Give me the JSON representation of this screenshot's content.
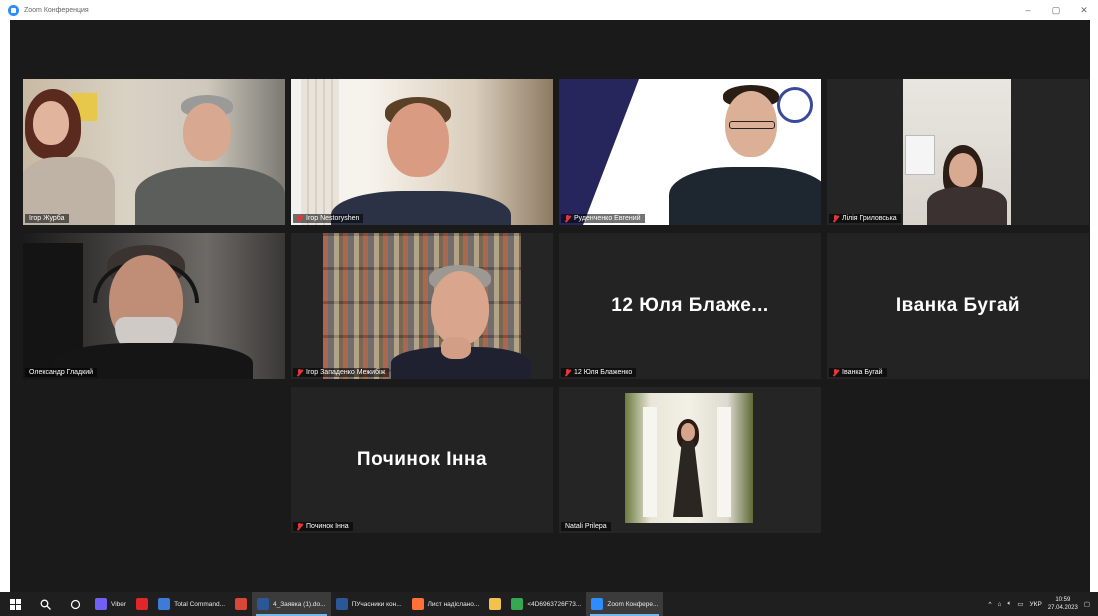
{
  "window": {
    "title": "Zoom Конференция",
    "controls": {
      "minimize": "–",
      "maximize": "▢",
      "close": "✕"
    }
  },
  "tiles": [
    {
      "name": "Ігор Журба",
      "muted": false,
      "speaking": true,
      "video": true
    },
    {
      "name": "Ігор Nestoryshen",
      "muted": true,
      "speaking": false,
      "video": true
    },
    {
      "name": "Руденченко Евгений",
      "muted": true,
      "speaking": false,
      "video": true
    },
    {
      "name": "Лілія Гриловська",
      "muted": true,
      "speaking": false,
      "video": true
    },
    {
      "name": "Олександр Гладкий",
      "muted": false,
      "speaking": false,
      "video": true
    },
    {
      "name": "Ігор Западенко Межибіж",
      "muted": true,
      "speaking": false,
      "video": true
    },
    {
      "name": "12 Юля Блаженко",
      "display_name": "12 Юля Блаже...",
      "muted": true,
      "speaking": false,
      "video": false
    },
    {
      "name": "Іванка Бугай",
      "display_name": "Іванка Бугай",
      "muted": true,
      "speaking": false,
      "video": false
    },
    {
      "name": "Починок Інна",
      "display_name": "Починок Інна",
      "muted": true,
      "speaking": false,
      "video": false
    },
    {
      "name": "Natali Prilepa",
      "muted": false,
      "speaking": false,
      "video": true
    }
  ],
  "taskbar": {
    "start_icon": "windows-logo-icon",
    "apps": [
      {
        "label": "Viber",
        "icon": "viber-icon",
        "color": "#7360f2",
        "active": false
      },
      {
        "label": "",
        "icon": "opera-icon",
        "color": "#e0262a",
        "active": false
      },
      {
        "label": "Total Command...",
        "icon": "total-commander-icon",
        "color": "#3d7bd6",
        "active": false
      },
      {
        "label": "",
        "icon": "shield-app-icon",
        "color": "#d94836",
        "active": false
      },
      {
        "label": "4_Заявка (1).do...",
        "icon": "word-icon",
        "color": "#2b5797",
        "active": true
      },
      {
        "label": "ПУчасники кон...",
        "icon": "word-icon",
        "color": "#2b5797",
        "active": false
      },
      {
        "label": "Лист надіслано...",
        "icon": "firefox-icon",
        "color": "#ff7139",
        "active": false
      },
      {
        "label": "",
        "icon": "file-explorer-icon",
        "color": "#f2c14e",
        "active": false
      },
      {
        "label": "<4D6963726F73...",
        "icon": "chrome-icon",
        "color": "#34a853",
        "active": false
      },
      {
        "label": "Zoom Конфере...",
        "icon": "zoom-icon",
        "color": "#2d8cff",
        "active": true
      }
    ],
    "tray": {
      "language": "УКР",
      "time": "10:59",
      "date": "27.04.2023"
    }
  }
}
